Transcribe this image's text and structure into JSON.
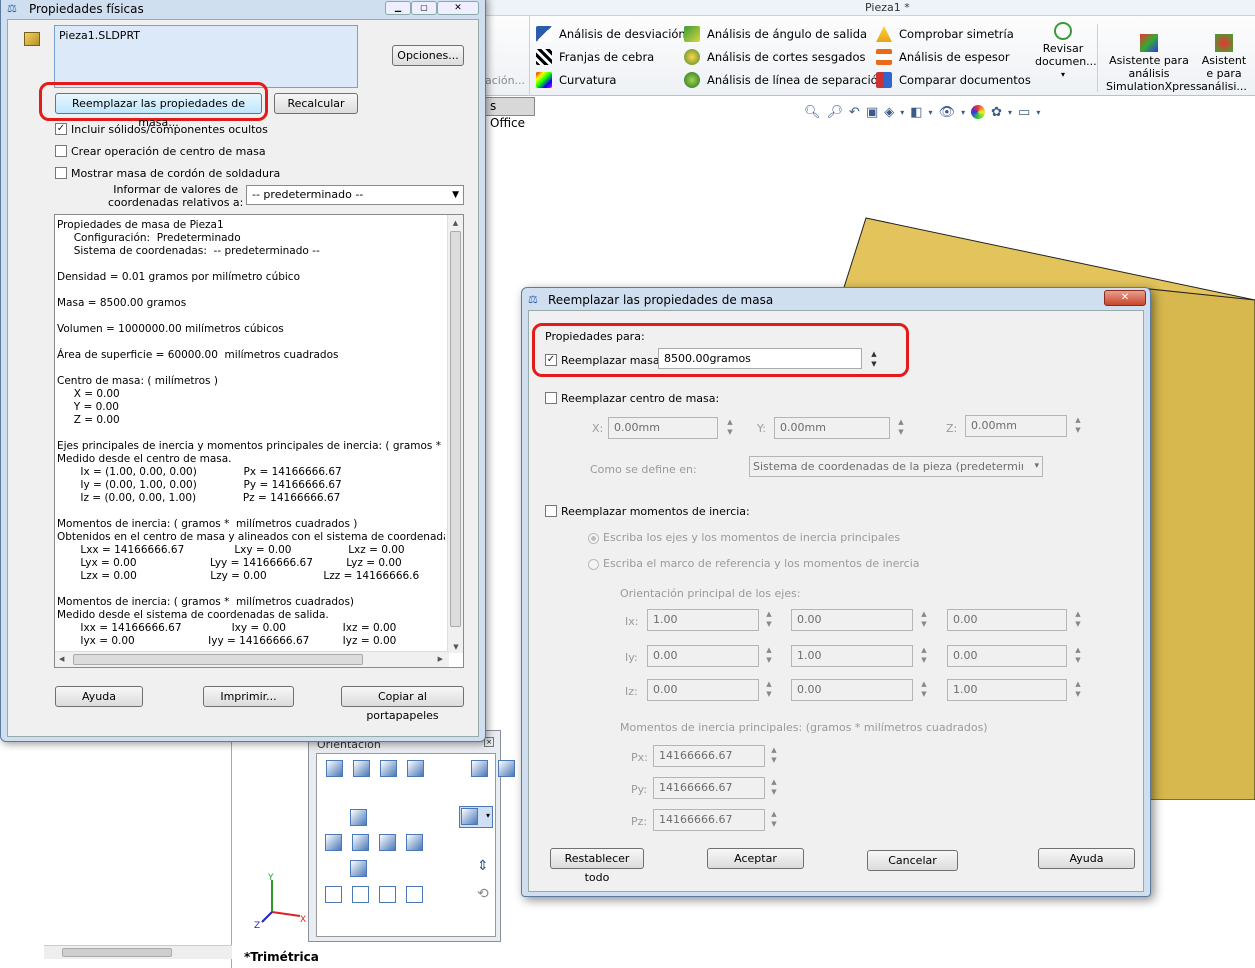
{
  "app": {
    "title": "Pieza1 *",
    "office_tab": "s Office",
    "toolbar": {
      "col1": [
        "Análisis de desviación",
        "Franjas de cebra",
        "Curvatura"
      ],
      "col2": [
        "Análisis de ángulo de salida",
        "Análisis de cortes sesgados",
        "Análisis de línea de separación"
      ],
      "col3": [
        "Comprobar simetría",
        "Análisis de espesor",
        "Comparar documentos"
      ],
      "revisar": "Revisar documen...",
      "asistente1": "Asistente para análisis SimulationXpress",
      "asistente2": "Asistent e para análisi...",
      "clipped": "ación..."
    },
    "view_label": "*Trimétrica",
    "colors": {
      "accent": "#2a5caa",
      "part": "#d9b84f",
      "part_side": "#a88a2c",
      "highlight": "#e31b1b"
    }
  },
  "physical": {
    "title": "Propiedades físicas",
    "file": "Pieza1.SLDPRT",
    "options_btn": "Opciones...",
    "override_btn": "Reemplazar las propiedades de masa...",
    "recalc_btn": "Recalcular",
    "include_hidden": "Incluir sólidos/componentes ocultos",
    "create_com": "Crear operación de centro de masa",
    "show_weld": "Mostrar masa de cordón de soldadura",
    "report_label_1": "Informar de valores de",
    "report_label_2": "coordenadas relativos a:",
    "report_value": "-- predeterminado --",
    "results": [
      "Propiedades de masa de Pieza1",
      "     Configuración:  Predeterminado",
      "     Sistema de coordenadas:  -- predeterminado --",
      "",
      "Densidad = 0.01 gramos por milímetro cúbico",
      "",
      "Masa = 8500.00 gramos",
      "",
      "Volumen = 1000000.00 milímetros cúbicos",
      "",
      "Área de superficie = 60000.00  milímetros cuadrados",
      "",
      "Centro de masa: ( milímetros )",
      "     X = 0.00",
      "     Y = 0.00",
      "     Z = 0.00",
      "",
      "Ejes principales de inercia y momentos principales de inercia: ( gramos *  mil",
      "Medido desde el centro de masa.",
      "       Ix = (1.00, 0.00, 0.00)              Px = 14166666.67",
      "       Iy = (0.00, 1.00, 0.00)              Py = 14166666.67",
      "       Iz = (0.00, 0.00, 1.00)              Pz = 14166666.67",
      "",
      "Momentos de inercia: ( gramos *  milímetros cuadrados )",
      "Obtenidos en el centro de masa y alineados con el sistema de coordenadas",
      "       Lxx = 14166666.67               Lxy = 0.00                 Lxz = 0.00",
      "       Lyx = 0.00                      Lyy = 14166666.67          Lyz = 0.00",
      "       Lzx = 0.00                      Lzy = 0.00                 Lzz = 14166666.6",
      "",
      "Momentos de inercia: ( gramos *  milímetros cuadrados)",
      "Medido desde el sistema de coordenadas de salida.",
      "       Ixx = 14166666.67               Ixy = 0.00                 Ixz = 0.00",
      "       Iyx = 0.00                      Iyy = 14166666.67          Iyz = 0.00"
    ],
    "help_btn": "Ayuda",
    "print_btn": "Imprimir...",
    "copy_btn": "Copiar al portapapeles"
  },
  "orientation": {
    "title": "Orientación"
  },
  "override": {
    "title": "Reemplazar las propiedades de masa",
    "props_for": "Propiedades para:",
    "override_mass": "Reemplazar masa:",
    "mass_value": "8500.00gramos",
    "override_com": "Reemplazar centro de masa:",
    "x_label": "X:",
    "x_value": "0.00mm",
    "y_label": "Y:",
    "y_value": "0.00mm",
    "z_label": "Z:",
    "z_value": "0.00mm",
    "defined_in": "Como se define en:",
    "coord_value": "Sistema de coordenadas de la pieza (predeterminado",
    "override_moi": "Reemplazar momentos de inercia:",
    "radio1": "Escriba los ejes y los momentos de inercia principales",
    "radio2": "Escriba el marco de referencia y los momentos de inercia",
    "axes_label": "Orientación principal de los ejes:",
    "ix": "Ix:",
    "iy": "Iy:",
    "iz": "Iz:",
    "ix_vals": [
      "1.00",
      "0.00",
      "0.00"
    ],
    "iy_vals": [
      "0.00",
      "1.00",
      "0.00"
    ],
    "iz_vals": [
      "0.00",
      "0.00",
      "1.00"
    ],
    "moments_label": "Momentos de inercia principales: (gramos *  milímetros cuadrados)",
    "px": "Px:",
    "py": "Py:",
    "pz": "Pz:",
    "px_val": "14166666.67",
    "py_val": "14166666.67",
    "pz_val": "14166666.67",
    "reset_btn": "Restablecer todo",
    "ok_btn": "Aceptar",
    "cancel_btn": "Cancelar",
    "help_btn": "Ayuda"
  }
}
